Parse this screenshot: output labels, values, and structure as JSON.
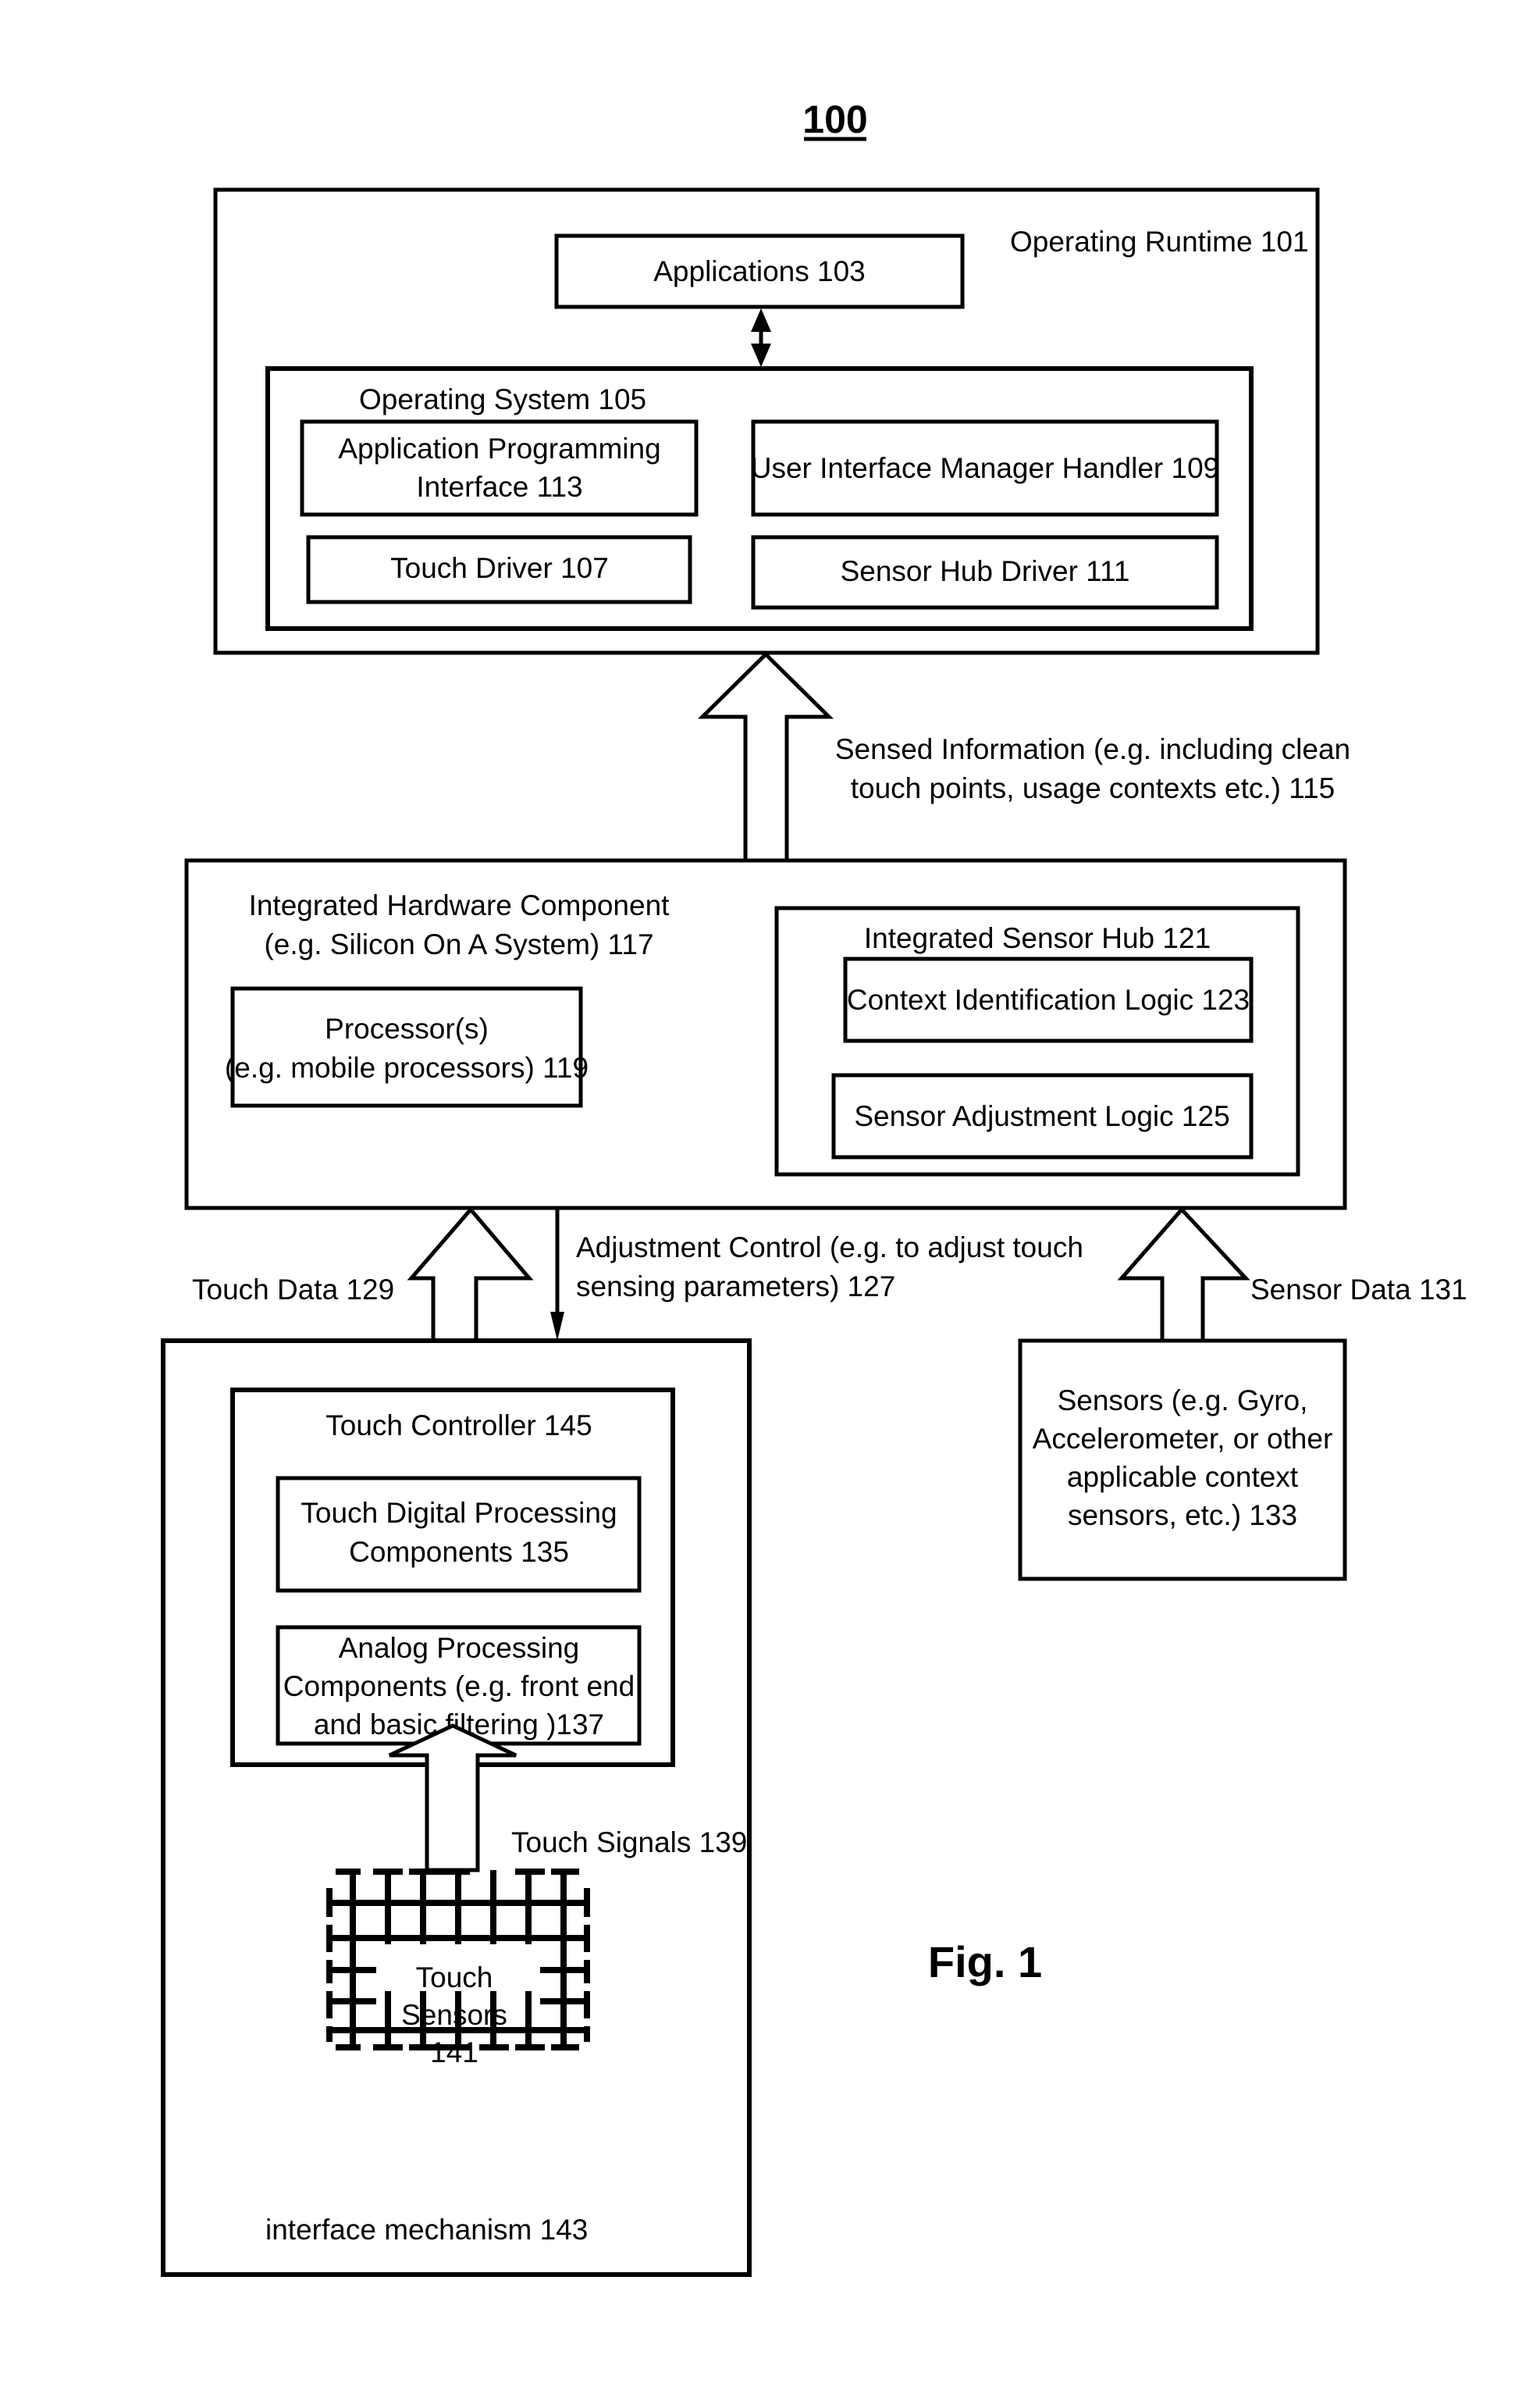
{
  "figure": {
    "reference_number": "100",
    "caption": "Fig. 1"
  },
  "operating_runtime": {
    "label": "Operating Runtime 101",
    "applications": "Applications 103",
    "operating_system": {
      "label": "Operating System 105",
      "api": [
        "Application Programming",
        "Interface 113"
      ],
      "ui_manager_handler": "User Interface Manager Handler 109",
      "touch_driver": "Touch Driver 107",
      "sensor_hub_driver": "Sensor Hub Driver 111"
    }
  },
  "sensed_information": [
    "Sensed Information (e.g. including clean",
    "touch points, usage contexts etc.) 115"
  ],
  "integrated_hardware": {
    "label": [
      "Integrated  Hardware Component",
      "(e.g. Silicon On A System) 117"
    ],
    "processors": [
      "Processor(s)",
      "(e.g. mobile processors) 119"
    ],
    "sensor_hub": {
      "label": "Integrated Sensor Hub 121",
      "context_logic": "Context Identification Logic 123",
      "adjustment_logic": "Sensor Adjustment  Logic 125"
    }
  },
  "touch_data": "Touch Data 129",
  "adjustment_control": [
    "Adjustment Control (e.g. to adjust touch",
    "sensing parameters) 127"
  ],
  "sensor_data": "Sensor Data 131",
  "sensors": [
    "Sensors (e.g. Gyro,",
    "Accelerometer, or other",
    "applicable context",
    "sensors, etc.) 133"
  ],
  "interface_mechanism": {
    "label": "interface mechanism 143",
    "touch_controller": {
      "label": "Touch Controller 145",
      "digital_processing": [
        "Touch Digital Processing",
        "Components 135"
      ],
      "analog_processing": [
        "Analog Processing",
        "Components (e.g. front end",
        "and basic filtering )137"
      ]
    },
    "touch_signals": "Touch Signals 139",
    "touch_sensors": [
      "Touch",
      "Sensors",
      "141"
    ]
  }
}
